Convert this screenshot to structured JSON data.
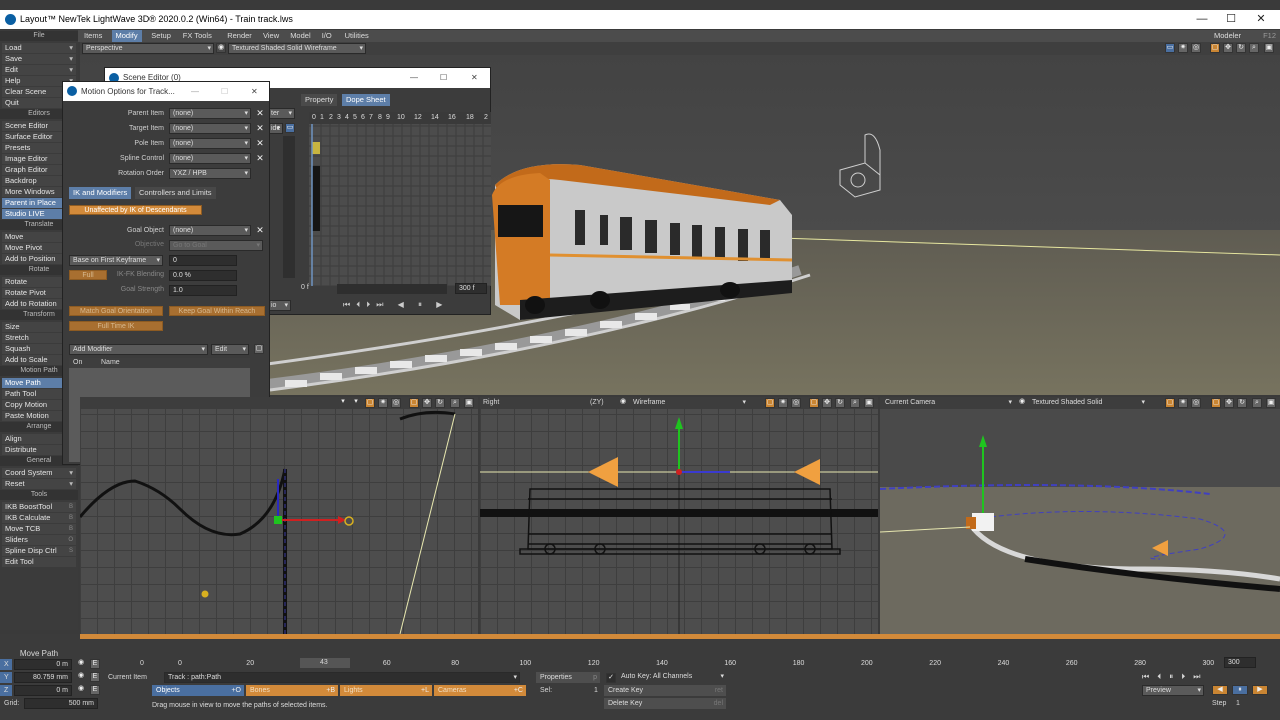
{
  "title": "Layout™ NewTek LightWave 3D® 2020.0.2 (Win64) - Train track.lws",
  "top_tabs": [
    "Items",
    "Modify",
    "Setup",
    "FX Tools",
    "Render",
    "View",
    "Model",
    "I/O",
    "Utilities"
  ],
  "active_tab": "Modify",
  "modeler_label": "Modeler",
  "modeler_shortcut": "F12",
  "main_view": {
    "camera": "Perspective",
    "shading": "Textured Shaded Solid Wireframe"
  },
  "sidebar": [
    {
      "type": "head",
      "label": "File"
    },
    {
      "label": "Load",
      "dd": true
    },
    {
      "label": "Save",
      "dd": true
    },
    {
      "label": "Edit",
      "dd": true
    },
    {
      "label": "Help",
      "dd": true
    },
    {
      "label": "Clear Scene"
    },
    {
      "label": "Quit"
    },
    {
      "type": "head",
      "label": "Editors"
    },
    {
      "label": "Scene Editor"
    },
    {
      "label": "Surface Editor"
    },
    {
      "label": "Presets"
    },
    {
      "label": "Image Editor"
    },
    {
      "label": "Graph Editor"
    },
    {
      "label": "Backdrop"
    },
    {
      "label": "More Windows",
      "dd": true
    },
    {
      "label": "Parent in Place",
      "hl": true
    },
    {
      "label": "Studio LIVE",
      "dd": true,
      "hl": true
    },
    {
      "type": "head",
      "label": "Translate"
    },
    {
      "label": "Move"
    },
    {
      "label": "Move Pivot"
    },
    {
      "label": "Add to Position"
    },
    {
      "type": "head",
      "label": "Rotate"
    },
    {
      "label": "Rotate"
    },
    {
      "label": "Rotate Pivot"
    },
    {
      "label": "Add to Rotation"
    },
    {
      "type": "head",
      "label": "Transform"
    },
    {
      "label": "Size"
    },
    {
      "label": "Stretch"
    },
    {
      "label": "Squash"
    },
    {
      "label": "Add to Scale"
    },
    {
      "type": "head",
      "label": "Motion Path"
    },
    {
      "label": "Move Path",
      "hl": true
    },
    {
      "label": "Path Tool"
    },
    {
      "label": "Copy Motion"
    },
    {
      "label": "Paste Motion"
    },
    {
      "type": "head",
      "label": "Arrange"
    },
    {
      "label": "Align"
    },
    {
      "label": "Distribute",
      "dd": true
    },
    {
      "type": "head",
      "label": "General"
    },
    {
      "label": "Coord System",
      "dd": true
    },
    {
      "label": "Reset",
      "dd": true
    },
    {
      "type": "head",
      "label": "Tools"
    },
    {
      "label": "IKB BoostTool",
      "sc": "B"
    },
    {
      "label": "IKB Calculate",
      "sc": "B"
    },
    {
      "label": "Move TCB",
      "sc": "B"
    },
    {
      "label": "Sliders",
      "sc": "O"
    },
    {
      "label": "Spline Disp Ctrl",
      "sc": "S"
    },
    {
      "label": "Edit Tool"
    }
  ],
  "scene_editor": {
    "title": "Scene Editor (0)",
    "tabs": [
      "Property",
      "Dope Sheet"
    ],
    "active_tab": "Dope Sheet",
    "ticks": [
      "0",
      "1",
      "2",
      "3",
      "4",
      "5",
      "6",
      "7",
      "8",
      "9",
      "10",
      "12",
      "14",
      "16",
      "18",
      "2"
    ],
    "start_frame": "0 f",
    "end_frame": "300 f",
    "filter_label": "ter",
    "side_label": "ide",
    "bottom_label": "io"
  },
  "motion_options": {
    "title": "Motion Options for Track...",
    "fields": [
      {
        "label": "Parent Item",
        "value": "(none)"
      },
      {
        "label": "Target Item",
        "value": "(none)"
      },
      {
        "label": "Pole Item",
        "value": "(none)"
      },
      {
        "label": "Spline Control",
        "value": "(none)"
      },
      {
        "label": "Rotation Order",
        "value": "YXZ / HPB"
      }
    ],
    "tabs": [
      "IK and Modifiers",
      "Controllers and Limits"
    ],
    "unaffected_label": "Unaffected by IK of Descendants",
    "goal_object_label": "Goal Object",
    "goal_object_value": "(none)",
    "objective_label": "Objective",
    "objective_value": "Go to Goal",
    "keyframe_mode": "Base on First Keyframe",
    "keyframe_value": "0",
    "full_time_ik": "Full",
    "ikfk_label": "IK-FK Blending",
    "ikfk_value": "0.0 %",
    "goal_strength_label": "Goal Strength",
    "goal_strength_value": "1.0",
    "btn_match_goal": "Match Goal Orientation",
    "btn_keep_goal": "Keep Goal Within Reach",
    "btn_full_ik": "Full Time IK",
    "add_modifier": "Add Modifier",
    "edit": "Edit",
    "col_on": "On",
    "col_name": "Name"
  },
  "viewports": [
    {
      "camera": "Right",
      "axes": "(ZY)",
      "shading": "Wireframe"
    },
    {
      "camera": "Current Camera",
      "axes": "",
      "shading": "Textured Shaded Solid"
    }
  ],
  "timeline": {
    "ticks": [
      "0",
      "20",
      "40",
      "60",
      "80",
      "100",
      "120",
      "140",
      "160",
      "180",
      "200",
      "220",
      "240",
      "260",
      "280",
      "300"
    ],
    "current_frame": "43",
    "end_frame": "300",
    "start_frame": "0"
  },
  "bottom": {
    "tool_label": "Move Path",
    "x": {
      "axis": "X",
      "value": "0 m"
    },
    "y": {
      "axis": "Y",
      "value": "80.759 mm"
    },
    "z": {
      "axis": "Z",
      "value": "0 m"
    },
    "grid_label": "Grid:",
    "grid_value": "500 mm",
    "current_item_label": "Current Item",
    "current_item_value": "Track : path:Path",
    "properties": "Properties",
    "properties_key": "p",
    "sel_label": "Sel:",
    "sel_value": "1",
    "auto_key": "Auto Key: All Channels",
    "create_key": "Create Key",
    "create_key_shortcut": "ret",
    "delete_key": "Delete Key",
    "delete_key_shortcut": "del",
    "item_types": [
      "Objects",
      "Bones",
      "Lights",
      "Cameras"
    ],
    "item_shortcuts": [
      "+O",
      "+B",
      "+L",
      "+C"
    ],
    "status": "Drag mouse in view to move the paths of selected items.",
    "preview": "Preview",
    "step_label": "Step",
    "step_value": "1"
  },
  "colors": {
    "accent": "#5d7ea8",
    "orange": "#d28a3a",
    "ground": "#6d6a5f"
  }
}
